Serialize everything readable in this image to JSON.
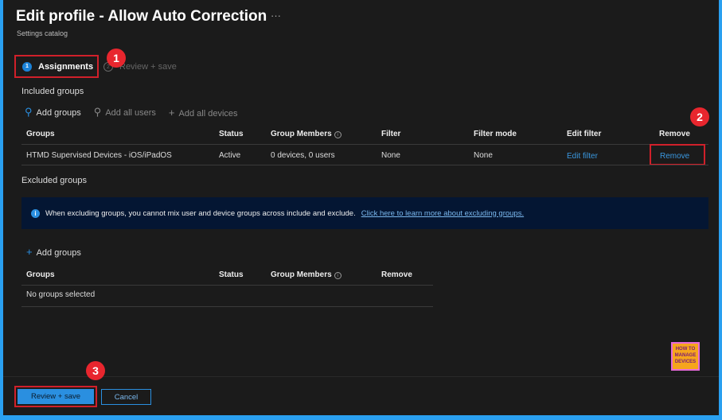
{
  "header": {
    "title": "Edit profile - Allow Auto Correction",
    "more": "···",
    "subtitle": "Settings catalog"
  },
  "tabs": [
    {
      "num": "1",
      "label": "Assignments"
    },
    {
      "num": "2",
      "label": "Review + save"
    }
  ],
  "badges": [
    "1",
    "2",
    "3"
  ],
  "included": {
    "heading": "Included groups",
    "toolbar": [
      "Add groups",
      "Add all users",
      "Add all devices"
    ],
    "columns": [
      "Groups",
      "Status",
      "Group Members",
      "Filter",
      "Filter mode",
      "Edit filter",
      "Remove"
    ],
    "rows": [
      {
        "group": "HTMD Supervised Devices - iOS/iPadOS",
        "status": "Active",
        "members": "0 devices, 0 users",
        "filter": "None",
        "filter_mode": "None",
        "edit_filter": "Edit filter",
        "remove": "Remove"
      }
    ]
  },
  "excluded": {
    "heading": "Excluded groups",
    "banner_text": "When excluding groups, you cannot mix user and device groups across include and exclude.",
    "banner_link": "Click here to learn more about excluding groups.",
    "add_groups": "Add groups",
    "columns": [
      "Groups",
      "Status",
      "Group Members",
      "Remove"
    ],
    "empty": "No groups selected"
  },
  "logo": {
    "line1": "HOW TO",
    "line2": "MANAGE",
    "line3": "DEVICES"
  },
  "footer": {
    "primary": "Review + save",
    "cancel": "Cancel"
  },
  "colors": {
    "accent": "#2a8fe0",
    "annotation": "#d0202a",
    "background": "#1b1b1b"
  }
}
